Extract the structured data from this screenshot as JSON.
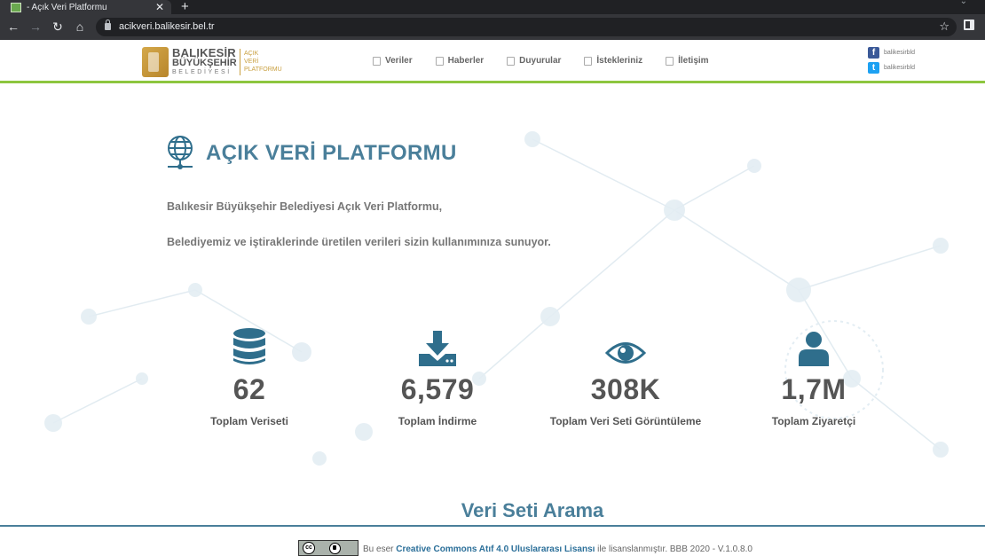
{
  "browser": {
    "tab_title": "- Açık Veri Platformu",
    "tab_close": "✕",
    "new_tab": "+",
    "tab_menu": "⌄",
    "back": "←",
    "forward": "→",
    "reload": "↻",
    "home": "⌂",
    "url": "acikveri.balikesir.bel.tr",
    "star": "☆"
  },
  "header": {
    "logo": {
      "line1": "BALIKESİR",
      "line2": "BÜYÜKŞEHİR",
      "line3": "BELEDİYESİ",
      "right1": "AÇIK",
      "right2": "VERİ",
      "right3": "PLATFORMU"
    },
    "nav": [
      {
        "label": "Veriler"
      },
      {
        "label": "Haberler"
      },
      {
        "label": "Duyurular"
      },
      {
        "label": "İstekleriniz"
      },
      {
        "label": "İletişim"
      }
    ],
    "social": {
      "facebook_label": "balikesirbld",
      "twitter_label": "balikesirbld",
      "facebook_glyph": "f",
      "twitter_glyph": "t"
    }
  },
  "main": {
    "title": "AÇIK VERİ PLATFORMU",
    "intro_line1": "Balıkesir Büyükşehir Belediyesi Açık Veri Platformu,",
    "intro_line2": "Belediyemiz ve iştiraklerinde üretilen verileri sizin kullanımınıza sunuyor.",
    "stats": [
      {
        "icon": "database-icon",
        "value": "62",
        "label": "Toplam Veriseti"
      },
      {
        "icon": "download-icon",
        "value": "6,579",
        "label": "Toplam İndirme"
      },
      {
        "icon": "eye-icon",
        "value": "308K",
        "label": "Toplam Veri Seti Görüntüleme"
      },
      {
        "icon": "user-icon",
        "value": "1,7M",
        "label": "Toplam Ziyaretçi"
      }
    ],
    "search_title": "Veri Seti Arama"
  },
  "footer": {
    "badge_cc": "cc",
    "text_before": "Bu eser ",
    "license_link": "Creative Commons Atıf 4.0 Uluslararası Lisansı",
    "text_after": " ile lisanslanmıştır. BBB 2020 - V.1.0.8.0"
  },
  "colors": {
    "accent": "#4a7f9a",
    "header_border": "#8dc63f",
    "icon": "#2f6e8c",
    "gold": "#c9a040"
  }
}
